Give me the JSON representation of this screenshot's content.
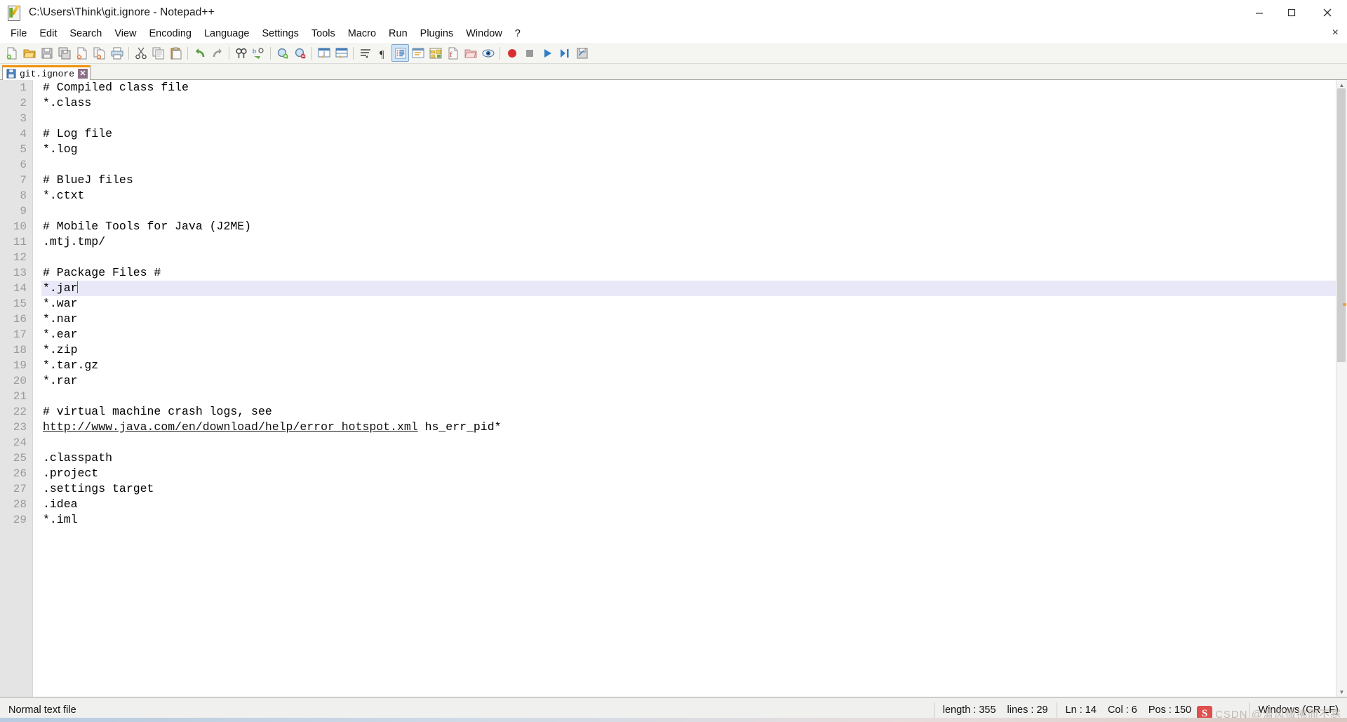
{
  "window": {
    "title": "C:\\Users\\Think\\git.ignore - Notepad++",
    "icon": "notepad-plus-plus-icon",
    "minimize_label": "Minimize",
    "maximize_label": "Restore",
    "close_label": "Close"
  },
  "menu": {
    "items": [
      {
        "label": "File"
      },
      {
        "label": "Edit"
      },
      {
        "label": "Search"
      },
      {
        "label": "View"
      },
      {
        "label": "Encoding"
      },
      {
        "label": "Language"
      },
      {
        "label": "Settings"
      },
      {
        "label": "Tools"
      },
      {
        "label": "Macro"
      },
      {
        "label": "Run"
      },
      {
        "label": "Plugins"
      },
      {
        "label": "Window"
      },
      {
        "label": "?"
      }
    ],
    "close_document_label": "×"
  },
  "toolbar": {
    "buttons": [
      {
        "name": "new-file-icon",
        "tip": "New"
      },
      {
        "name": "open-file-icon",
        "tip": "Open"
      },
      {
        "name": "save-icon",
        "tip": "Save"
      },
      {
        "name": "save-all-icon",
        "tip": "Save All"
      },
      {
        "name": "close-file-icon",
        "tip": "Close"
      },
      {
        "name": "close-all-files-icon",
        "tip": "Close All"
      },
      {
        "name": "print-icon",
        "tip": "Print"
      },
      {
        "name": "separator-1",
        "tip": ""
      },
      {
        "name": "cut-icon",
        "tip": "Cut"
      },
      {
        "name": "copy-icon",
        "tip": "Copy"
      },
      {
        "name": "paste-icon",
        "tip": "Paste"
      },
      {
        "name": "separator-2",
        "tip": ""
      },
      {
        "name": "undo-icon",
        "tip": "Undo"
      },
      {
        "name": "redo-icon",
        "tip": "Redo"
      },
      {
        "name": "separator-3",
        "tip": ""
      },
      {
        "name": "find-icon",
        "tip": "Find"
      },
      {
        "name": "replace-icon",
        "tip": "Replace"
      },
      {
        "name": "separator-4",
        "tip": ""
      },
      {
        "name": "zoom-in-icon",
        "tip": "Zoom In"
      },
      {
        "name": "zoom-out-icon",
        "tip": "Zoom Out"
      },
      {
        "name": "separator-5",
        "tip": ""
      },
      {
        "name": "sync-vertical-scrolling-icon",
        "tip": "Synchronize Vertical Scrolling"
      },
      {
        "name": "sync-horizontal-scrolling-icon",
        "tip": "Synchronize Horizontal Scrolling"
      },
      {
        "name": "separator-6",
        "tip": ""
      },
      {
        "name": "word-wrap-icon",
        "tip": "Word wrap"
      },
      {
        "name": "show-all-characters-icon",
        "tip": "Show All Characters"
      },
      {
        "name": "indent-guide-icon",
        "tip": "Show Indent Guide"
      },
      {
        "name": "user-defined-dialog-icon",
        "tip": "User-Defined Dialogue"
      },
      {
        "name": "document-map-icon",
        "tip": "Document Map"
      },
      {
        "name": "function-list-icon",
        "tip": "Function List"
      },
      {
        "name": "folder-as-workspace-icon",
        "tip": "Folder as Workspace"
      },
      {
        "name": "monitoring-icon",
        "tip": "Monitoring (tail -f)"
      },
      {
        "name": "separator-7",
        "tip": ""
      },
      {
        "name": "record-macro-icon",
        "tip": "Start Recording"
      },
      {
        "name": "stop-macro-icon",
        "tip": "Stop Recording"
      },
      {
        "name": "playback-macro-icon",
        "tip": "Playback"
      },
      {
        "name": "run-macro-multiple-icon",
        "tip": "Run a Macro Multiple Times"
      },
      {
        "name": "save-macro-icon",
        "tip": "Save Current Recorded Macro"
      }
    ]
  },
  "tabs": [
    {
      "label": "git.ignore",
      "icon": "saved-file-icon",
      "close": "✕",
      "active": true
    }
  ],
  "editor": {
    "current_line": 14,
    "caret_after_col": 5,
    "lines": [
      {
        "n": 1,
        "text": "# Compiled class file"
      },
      {
        "n": 2,
        "text": "*.class"
      },
      {
        "n": 3,
        "text": ""
      },
      {
        "n": 4,
        "text": "# Log file"
      },
      {
        "n": 5,
        "text": "*.log"
      },
      {
        "n": 6,
        "text": ""
      },
      {
        "n": 7,
        "text": "# BlueJ files"
      },
      {
        "n": 8,
        "text": "*.ctxt"
      },
      {
        "n": 9,
        "text": ""
      },
      {
        "n": 10,
        "text": "# Mobile Tools for Java (J2ME)"
      },
      {
        "n": 11,
        "text": ".mtj.tmp/"
      },
      {
        "n": 12,
        "text": ""
      },
      {
        "n": 13,
        "text": "# Package Files #"
      },
      {
        "n": 14,
        "text": "*.jar"
      },
      {
        "n": 15,
        "text": "*.war"
      },
      {
        "n": 16,
        "text": "*.nar"
      },
      {
        "n": 17,
        "text": "*.ear"
      },
      {
        "n": 18,
        "text": "*.zip"
      },
      {
        "n": 19,
        "text": "*.tar.gz"
      },
      {
        "n": 20,
        "text": "*.rar"
      },
      {
        "n": 21,
        "text": ""
      },
      {
        "n": 22,
        "text": "# virtual machine crash logs, see"
      },
      {
        "n": 23,
        "text": "http://www.java.com/en/download/help/error_hotspot.xml hs_err_pid*",
        "link": "http://www.java.com/en/download/help/error_hotspot.xml",
        "rest": " hs_err_pid*"
      },
      {
        "n": 24,
        "text": ""
      },
      {
        "n": 25,
        "text": ".classpath"
      },
      {
        "n": 26,
        "text": ".project"
      },
      {
        "n": 27,
        "text": ".settings target"
      },
      {
        "n": 28,
        "text": ".idea"
      },
      {
        "n": 29,
        "text": "*.iml"
      }
    ]
  },
  "statusbar": {
    "file_type": "Normal text file",
    "length": "length : 355",
    "lines": "lines : 29",
    "ln": "Ln : 14",
    "col": "Col : 6",
    "pos": "Pos : 150",
    "eol": "Windows (CR LF)"
  },
  "watermark": {
    "logo": "S",
    "text": "CSDN @清风微拂面不寒"
  },
  "colors": {
    "tab_active_top": "#f09000",
    "current_line_highlight": "#e8e8f8",
    "caret": "#7a3fbf",
    "gutter_bg": "#e4e4e4",
    "gutter_fg": "#9a9a9a",
    "toolbar_bg": "#f5f5f2",
    "statusbar_bg": "#f0f0ee"
  }
}
